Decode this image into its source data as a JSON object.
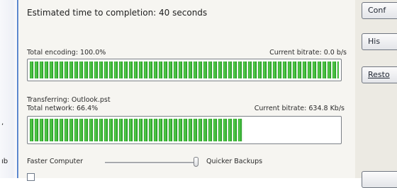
{
  "left": {
    "fragment_top": ",",
    "fragment_bottom": "ıb"
  },
  "progress": {
    "eta_text": "Estimated time to completion: 40 seconds",
    "encoding": {
      "label": "Total encoding: 100.0%",
      "bitrate": "Current bitrate: 0.0 b/s",
      "fraction": 1.0
    },
    "transfer": {
      "file_label": "Transferring: Outlook.pst",
      "label": "Total network: 66.4%",
      "bitrate": "Current bitrate: 634.8 Kb/s",
      "fraction": 0.69
    }
  },
  "speed": {
    "left_label": "Faster Computer",
    "right_label": "Quicker Backups"
  },
  "buttons": {
    "config": "Conf",
    "history": "His",
    "restore": "Resto"
  }
}
